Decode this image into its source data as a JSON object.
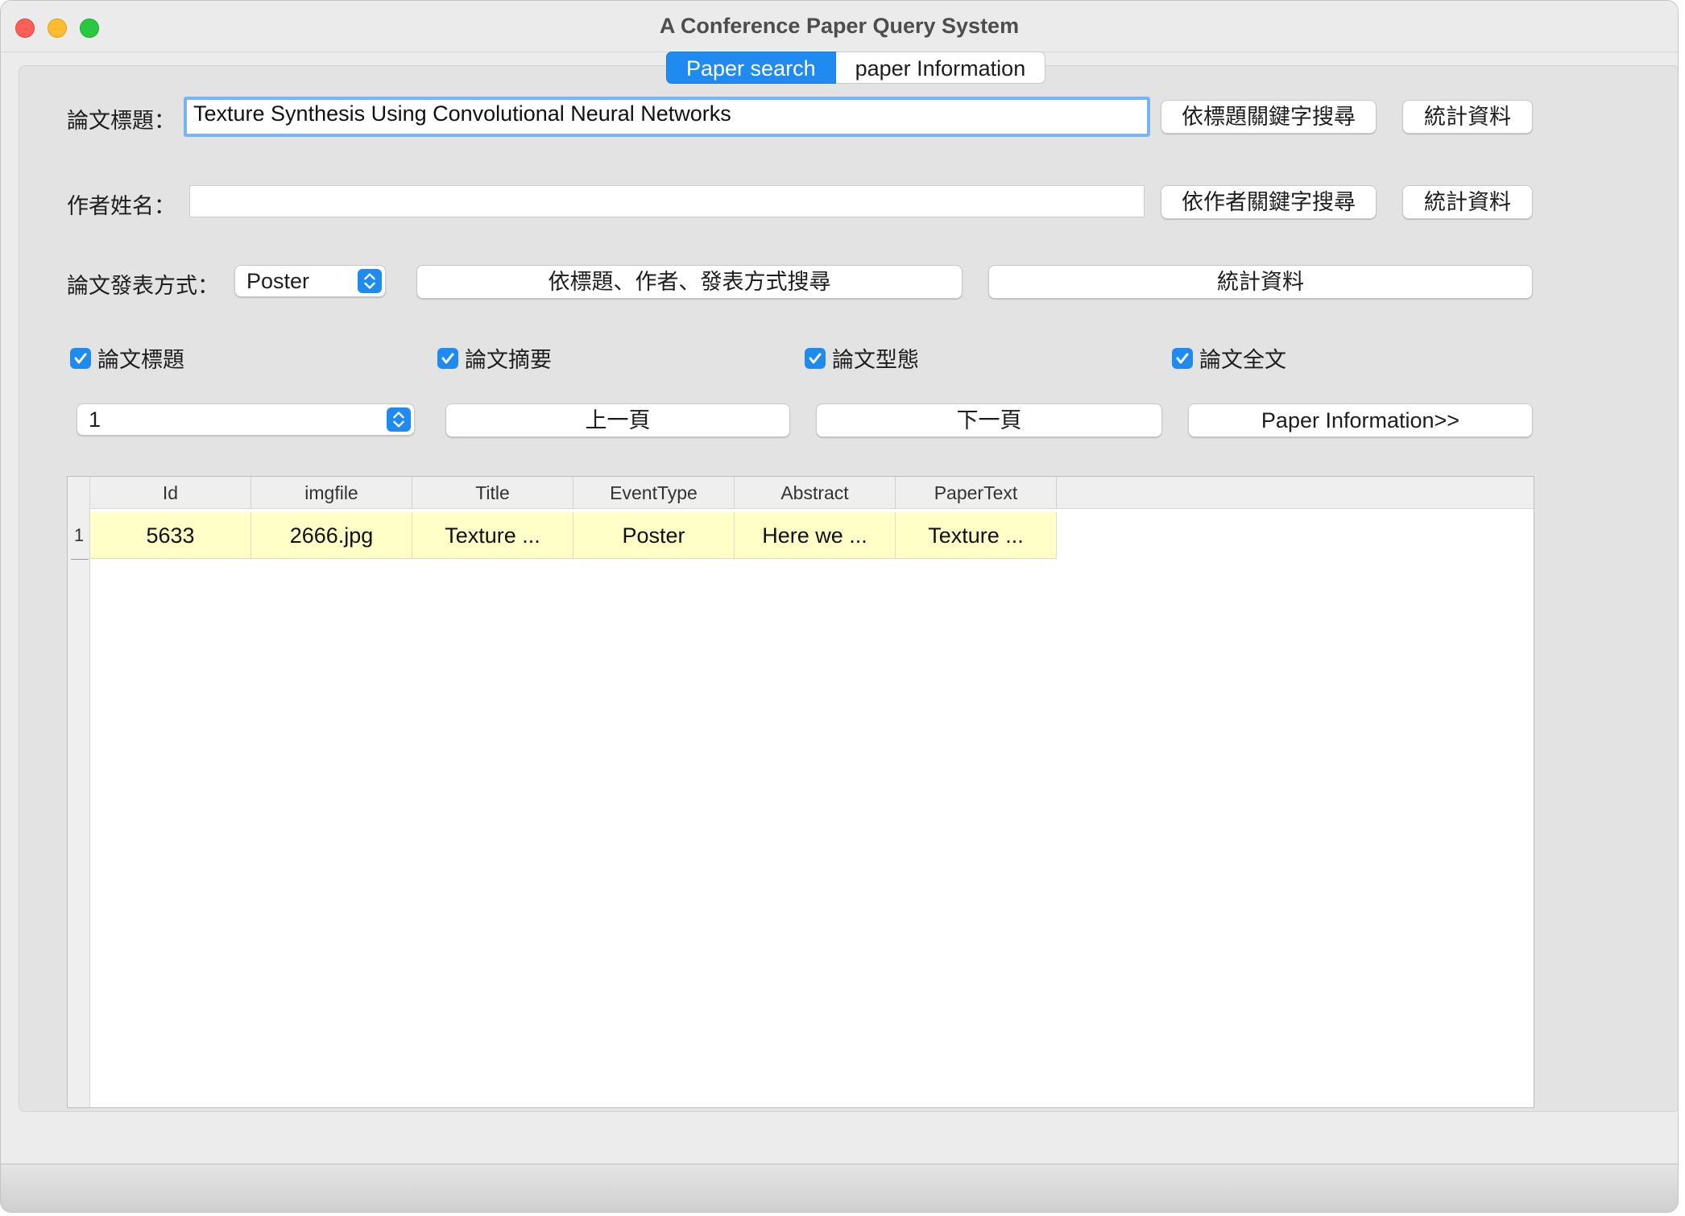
{
  "window": {
    "title": "A Conference Paper Query System"
  },
  "tabs": [
    {
      "label": "Paper search",
      "active": true
    },
    {
      "label": "paper Information",
      "active": false
    }
  ],
  "title_row": {
    "label": "論文標題：",
    "value": "Texture Synthesis Using Convolutional Neural Networks",
    "search_button": "依標題關鍵字搜尋",
    "stats_button": "統計資料"
  },
  "author_row": {
    "label": "作者姓名：",
    "value": "",
    "search_button": "依作者關鍵字搜尋",
    "stats_button": "統計資料"
  },
  "publish_row": {
    "label": "論文發表方式：",
    "selected": "Poster",
    "search_button": "依標題、作者、發表方式搜尋",
    "stats_button": "統計資料"
  },
  "checkboxes": [
    {
      "label": "論文標題",
      "checked": true
    },
    {
      "label": "論文摘要",
      "checked": true
    },
    {
      "label": "論文型態",
      "checked": true
    },
    {
      "label": "論文全文",
      "checked": true
    }
  ],
  "pagination": {
    "page_selected": "1",
    "prev_button": "上一頁",
    "next_button": "下一頁",
    "info_button": "Paper Information>>"
  },
  "table": {
    "columns": [
      "Id",
      "imgfile",
      "Title",
      "EventType",
      "Abstract",
      "PaperText"
    ],
    "rows": [
      {
        "number": "1",
        "cells": [
          "5633",
          "2666.jpg",
          "Texture ...",
          "Poster",
          "Here we ...",
          "Texture ..."
        ]
      }
    ]
  },
  "colors": {
    "accent": "#1f8bf0",
    "row_highlight": "#ffffc8"
  }
}
